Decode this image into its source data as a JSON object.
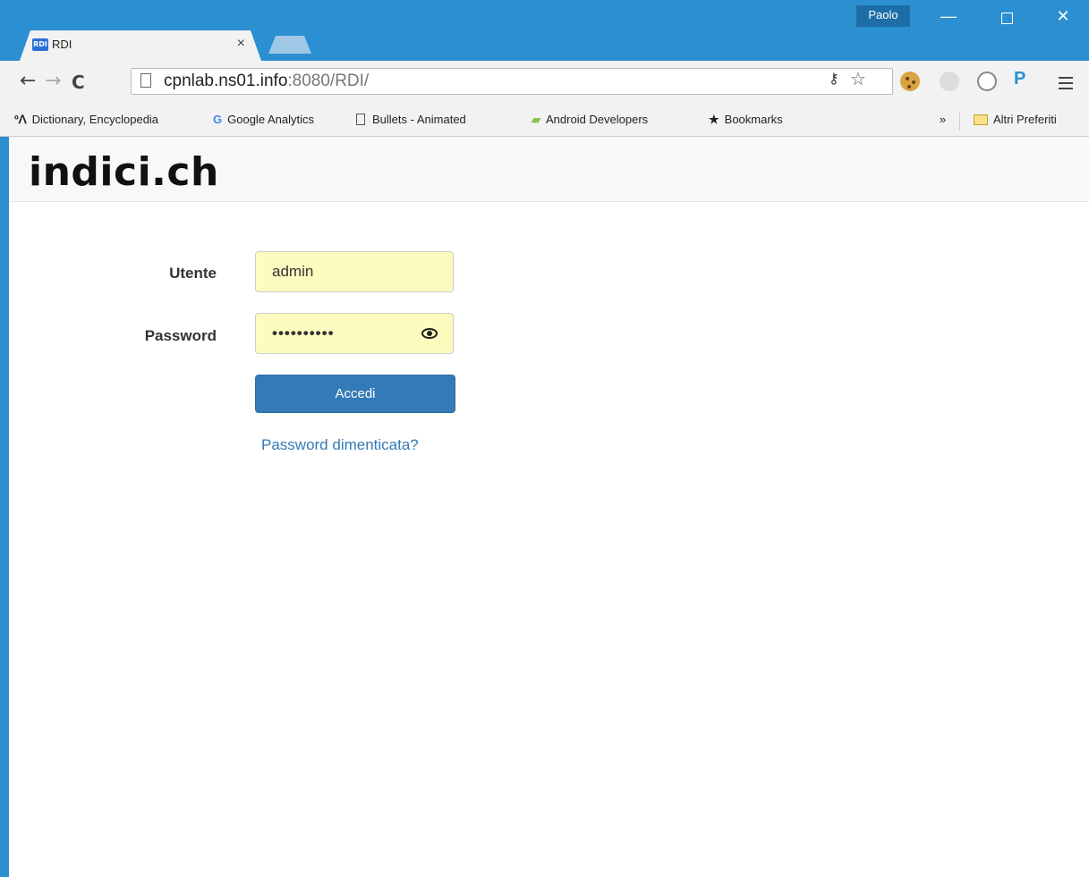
{
  "browser": {
    "profile_name": "Paolo",
    "tab": {
      "favicon_text": "RDI",
      "title": "RDI",
      "close_label": "×"
    },
    "window_controls": {
      "minimize": "—",
      "close": "✕"
    },
    "address": {
      "host": "cpnlab.ns01.info",
      "path": ":8080/RDI/"
    },
    "bookmarks": [
      {
        "label": "Dictionary, Encyclopedia",
        "icon": "dictionary-icon"
      },
      {
        "label": "Google Analytics",
        "icon": "google-icon"
      },
      {
        "label": "Bullets - Animated",
        "icon": "page-icon"
      },
      {
        "label": "Android Developers",
        "icon": "android-icon"
      },
      {
        "label": "Bookmarks",
        "icon": "star-icon"
      }
    ],
    "bookmarks_overflow": "»",
    "other_bookmarks": "Altri Preferiti"
  },
  "page": {
    "brand": "indici.ch",
    "form": {
      "username_label": "Utente",
      "username_value": "admin",
      "password_label": "Password",
      "password_value": "••••••••••",
      "submit_label": "Accedi",
      "forgot_link": "Password dimenticata?"
    }
  },
  "colors": {
    "titlebar": "#2b8fd1",
    "autofill": "#fcfcbf",
    "primary": "#337ab7"
  }
}
